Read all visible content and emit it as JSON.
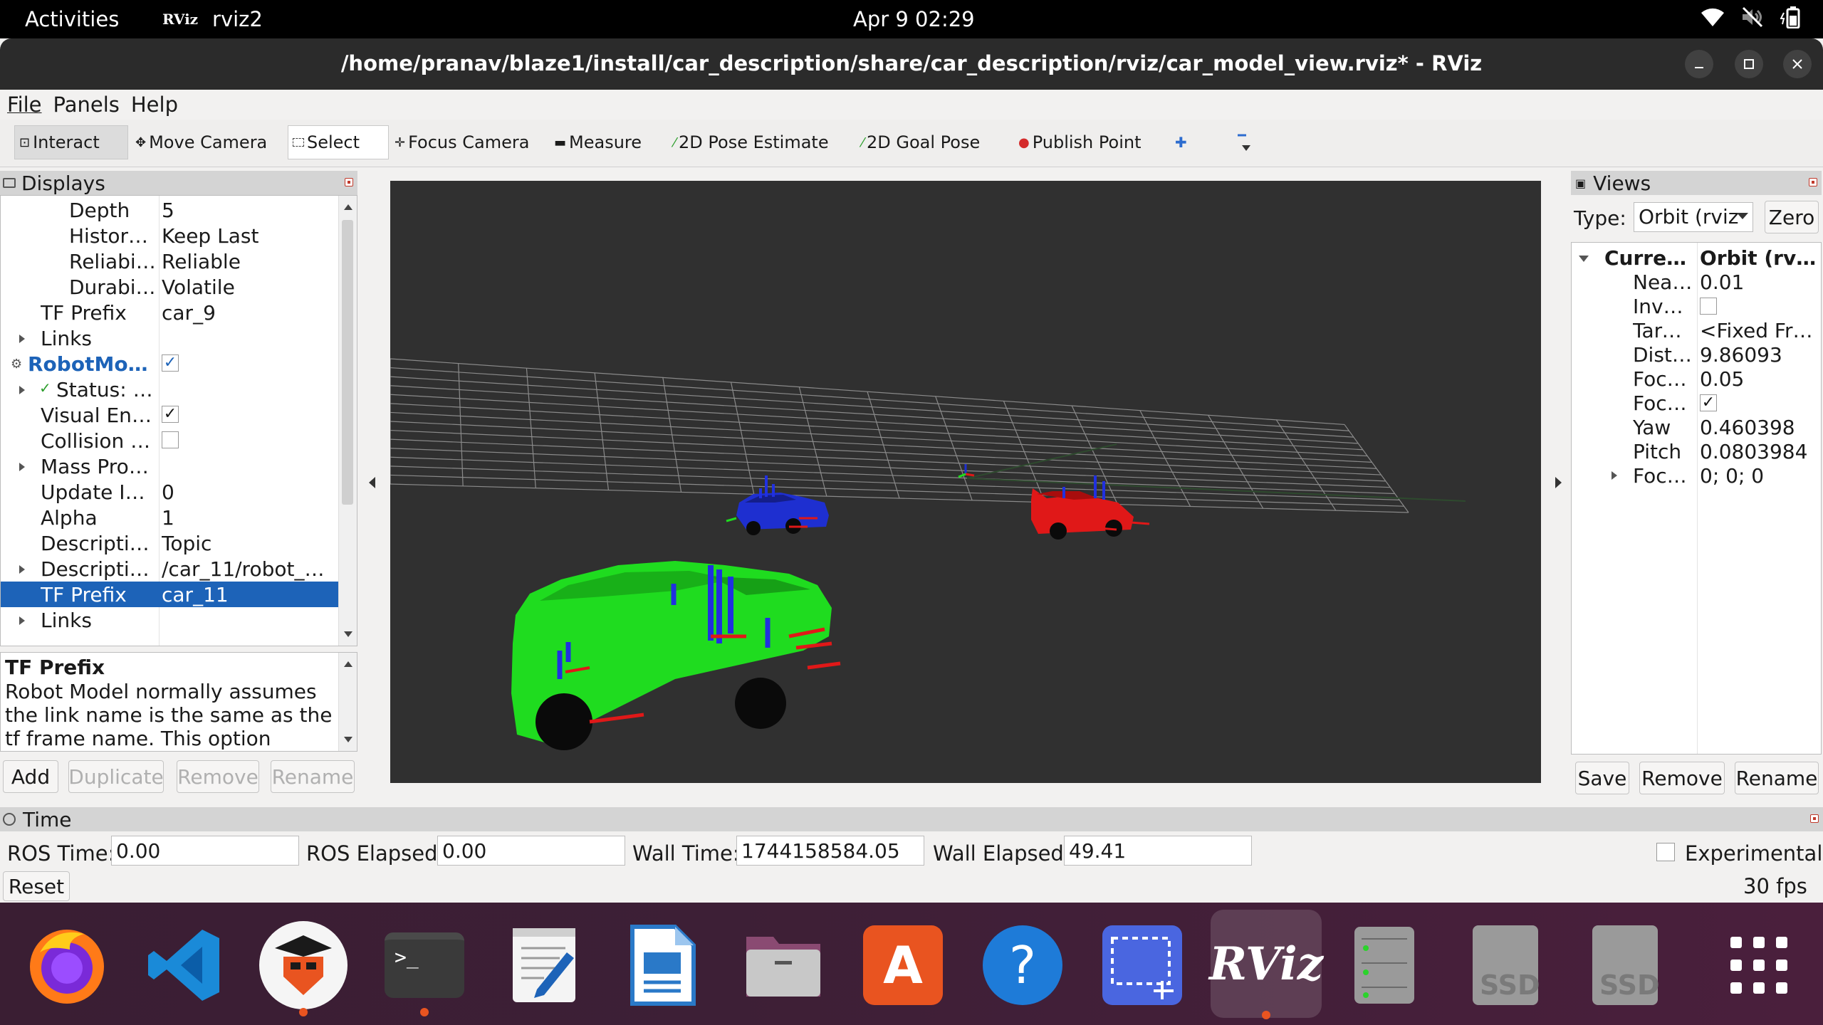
{
  "topbar": {
    "activities": "Activities",
    "app_logo": "RViz",
    "app_name": "rviz2",
    "clock": "Apr 9  02:29",
    "tray_icons": [
      "wifi-icon",
      "volume-muted-icon",
      "battery-icon"
    ]
  },
  "window": {
    "title": "/home/pranav/blaze1/install/car_description/share/car_description/rviz/car_model_view.rviz* - RViz",
    "controls": [
      "minimize-icon",
      "maximize-icon",
      "close-icon"
    ]
  },
  "menu": {
    "file": "File",
    "panels": "Panels",
    "help": "Help"
  },
  "toolbar": {
    "interact": "Interact",
    "move_camera": "Move Camera",
    "select": "Select",
    "focus_camera": "Focus Camera",
    "measure": "Measure",
    "pose_estimate": "2D Pose Estimate",
    "goal_pose": "2D Goal Pose",
    "publish_point": "Publish Point"
  },
  "displays": {
    "title": "Displays",
    "rows": [
      {
        "key": "Depth",
        "value": "5"
      },
      {
        "key": "Histor…",
        "value": "Keep Last"
      },
      {
        "key": "Reliabi…",
        "value": "Reliable"
      },
      {
        "key": "Durabi…",
        "value": "Volatile"
      },
      {
        "key": "TF Prefix",
        "value": "car_9"
      },
      {
        "key": "Links",
        "value": ""
      },
      {
        "key": "RobotModel",
        "value": ""
      },
      {
        "key": "Status: Ok",
        "value": ""
      },
      {
        "key": "Visual Ena…",
        "value": ""
      },
      {
        "key": "Collision E…",
        "value": ""
      },
      {
        "key": "Mass Pro…",
        "value": ""
      },
      {
        "key": "Update In…",
        "value": "0"
      },
      {
        "key": "Alpha",
        "value": "1"
      },
      {
        "key": "Descriptio…",
        "value": "Topic"
      },
      {
        "key": "Descriptio…",
        "value": "/car_11/robot_d…"
      },
      {
        "key": "TF Prefix",
        "value": "car_11"
      },
      {
        "key": "Links",
        "value": ""
      }
    ],
    "status_check": "✓",
    "checkmark": "✓",
    "description": {
      "title": "TF Prefix",
      "text": "Robot Model normally assumes the link name is the same as the tf frame name. This option allows you"
    },
    "buttons": {
      "add": "Add",
      "duplicate": "Duplicate",
      "remove": "Remove",
      "rename": "Rename"
    }
  },
  "views": {
    "title": "Views",
    "type_label": "Type:",
    "type_value": "Orbit (rviz",
    "zero": "Zero",
    "current_key": "Curren…",
    "current_value": "Orbit (rviz)",
    "rows": [
      {
        "key": "Nea…",
        "value": "0.01"
      },
      {
        "key": "Inve…",
        "value": ""
      },
      {
        "key": "Targ…",
        "value": "<Fixed Fra…"
      },
      {
        "key": "Dist…",
        "value": "9.86093"
      },
      {
        "key": "Foc…",
        "value": "0.05"
      },
      {
        "key": "Foc…",
        "value": ""
      },
      {
        "key": "Yaw",
        "value": "0.460398"
      },
      {
        "key": "Pitch",
        "value": "0.0803984"
      },
      {
        "key": "Foc…",
        "value": "0; 0; 0"
      }
    ],
    "checkmark": "✓",
    "buttons": {
      "save": "Save",
      "remove": "Remove",
      "rename": "Rename"
    }
  },
  "time": {
    "title": "Time",
    "ros_time_label": "ROS Time:",
    "ros_time": "0.00",
    "ros_elapsed_label": "ROS Elapsed:",
    "ros_elapsed": "0.00",
    "wall_time_label": "Wall Time:",
    "wall_time": "1744158584.05",
    "wall_elapsed_label": "Wall Elapsed:",
    "wall_elapsed": "49.41",
    "experimental": "Experimental",
    "reset": "Reset",
    "fps": "30 fps"
  },
  "dock": {
    "items": [
      "firefox-icon",
      "vscode-icon",
      "robot-app-icon",
      "terminal-icon",
      "text-editor-icon",
      "libreoffice-writer-icon",
      "files-icon",
      "app-center-icon",
      "help-icon",
      "screenshot-icon",
      "rviz-icon",
      "disks-icon",
      "ssd-drive-icon",
      "ssd-drive-icon",
      "show-apps-icon"
    ],
    "terminal_prompt": ">_",
    "rviz_label": "RViz",
    "ssd_label": "SSD",
    "help_label": "?",
    "app_center_label": "A"
  },
  "colors": {
    "render_bg": "#303030",
    "selection": "#1d63b8",
    "robot_link": "#1d63b8",
    "green_car": "#1fdc1f",
    "blue_car": "#1e2fd0",
    "red_car": "#e01818",
    "ubuntu_orange": "#e95420"
  }
}
